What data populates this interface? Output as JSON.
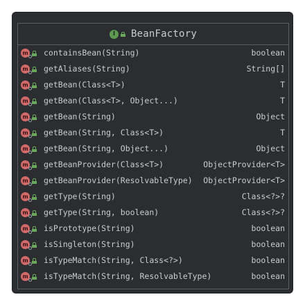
{
  "class_node": {
    "name": "BeanFactory",
    "kind_icon": "interface-icon",
    "visibility_icon": "public-lock-icon"
  },
  "methods": [
    {
      "signature": "containsBean(String)",
      "return_type": "boolean"
    },
    {
      "signature": "getAliases(String)",
      "return_type": "String[]"
    },
    {
      "signature": "getBean(Class<T>)",
      "return_type": "T"
    },
    {
      "signature": "getBean(Class<T>, Object...)",
      "return_type": "T"
    },
    {
      "signature": "getBean(String)",
      "return_type": "Object"
    },
    {
      "signature": "getBean(String, Class<T>)",
      "return_type": "T"
    },
    {
      "signature": "getBean(String, Object...)",
      "return_type": "Object"
    },
    {
      "signature": "getBeanProvider(Class<T>)",
      "return_type": "ObjectProvider<T>"
    },
    {
      "signature": "getBeanProvider(ResolvableType)",
      "return_type": "ObjectProvider<T>"
    },
    {
      "signature": "getType(String)",
      "return_type": "Class<?>?"
    },
    {
      "signature": "getType(String, boolean)",
      "return_type": "Class<?>?"
    },
    {
      "signature": "isPrototype(String)",
      "return_type": "boolean"
    },
    {
      "signature": "isSingleton(String)",
      "return_type": "boolean"
    },
    {
      "signature": "isTypeMatch(String, Class<?>)",
      "return_type": "boolean"
    },
    {
      "signature": "isTypeMatch(String, ResolvableType)",
      "return_type": "boolean"
    }
  ],
  "method_icon": "abstract-method-icon",
  "colors": {
    "panel_bg": "#2b2d30",
    "text": "#c9ccd1",
    "interface_green": "#5f9a52",
    "method_red": "#d36a6a"
  }
}
